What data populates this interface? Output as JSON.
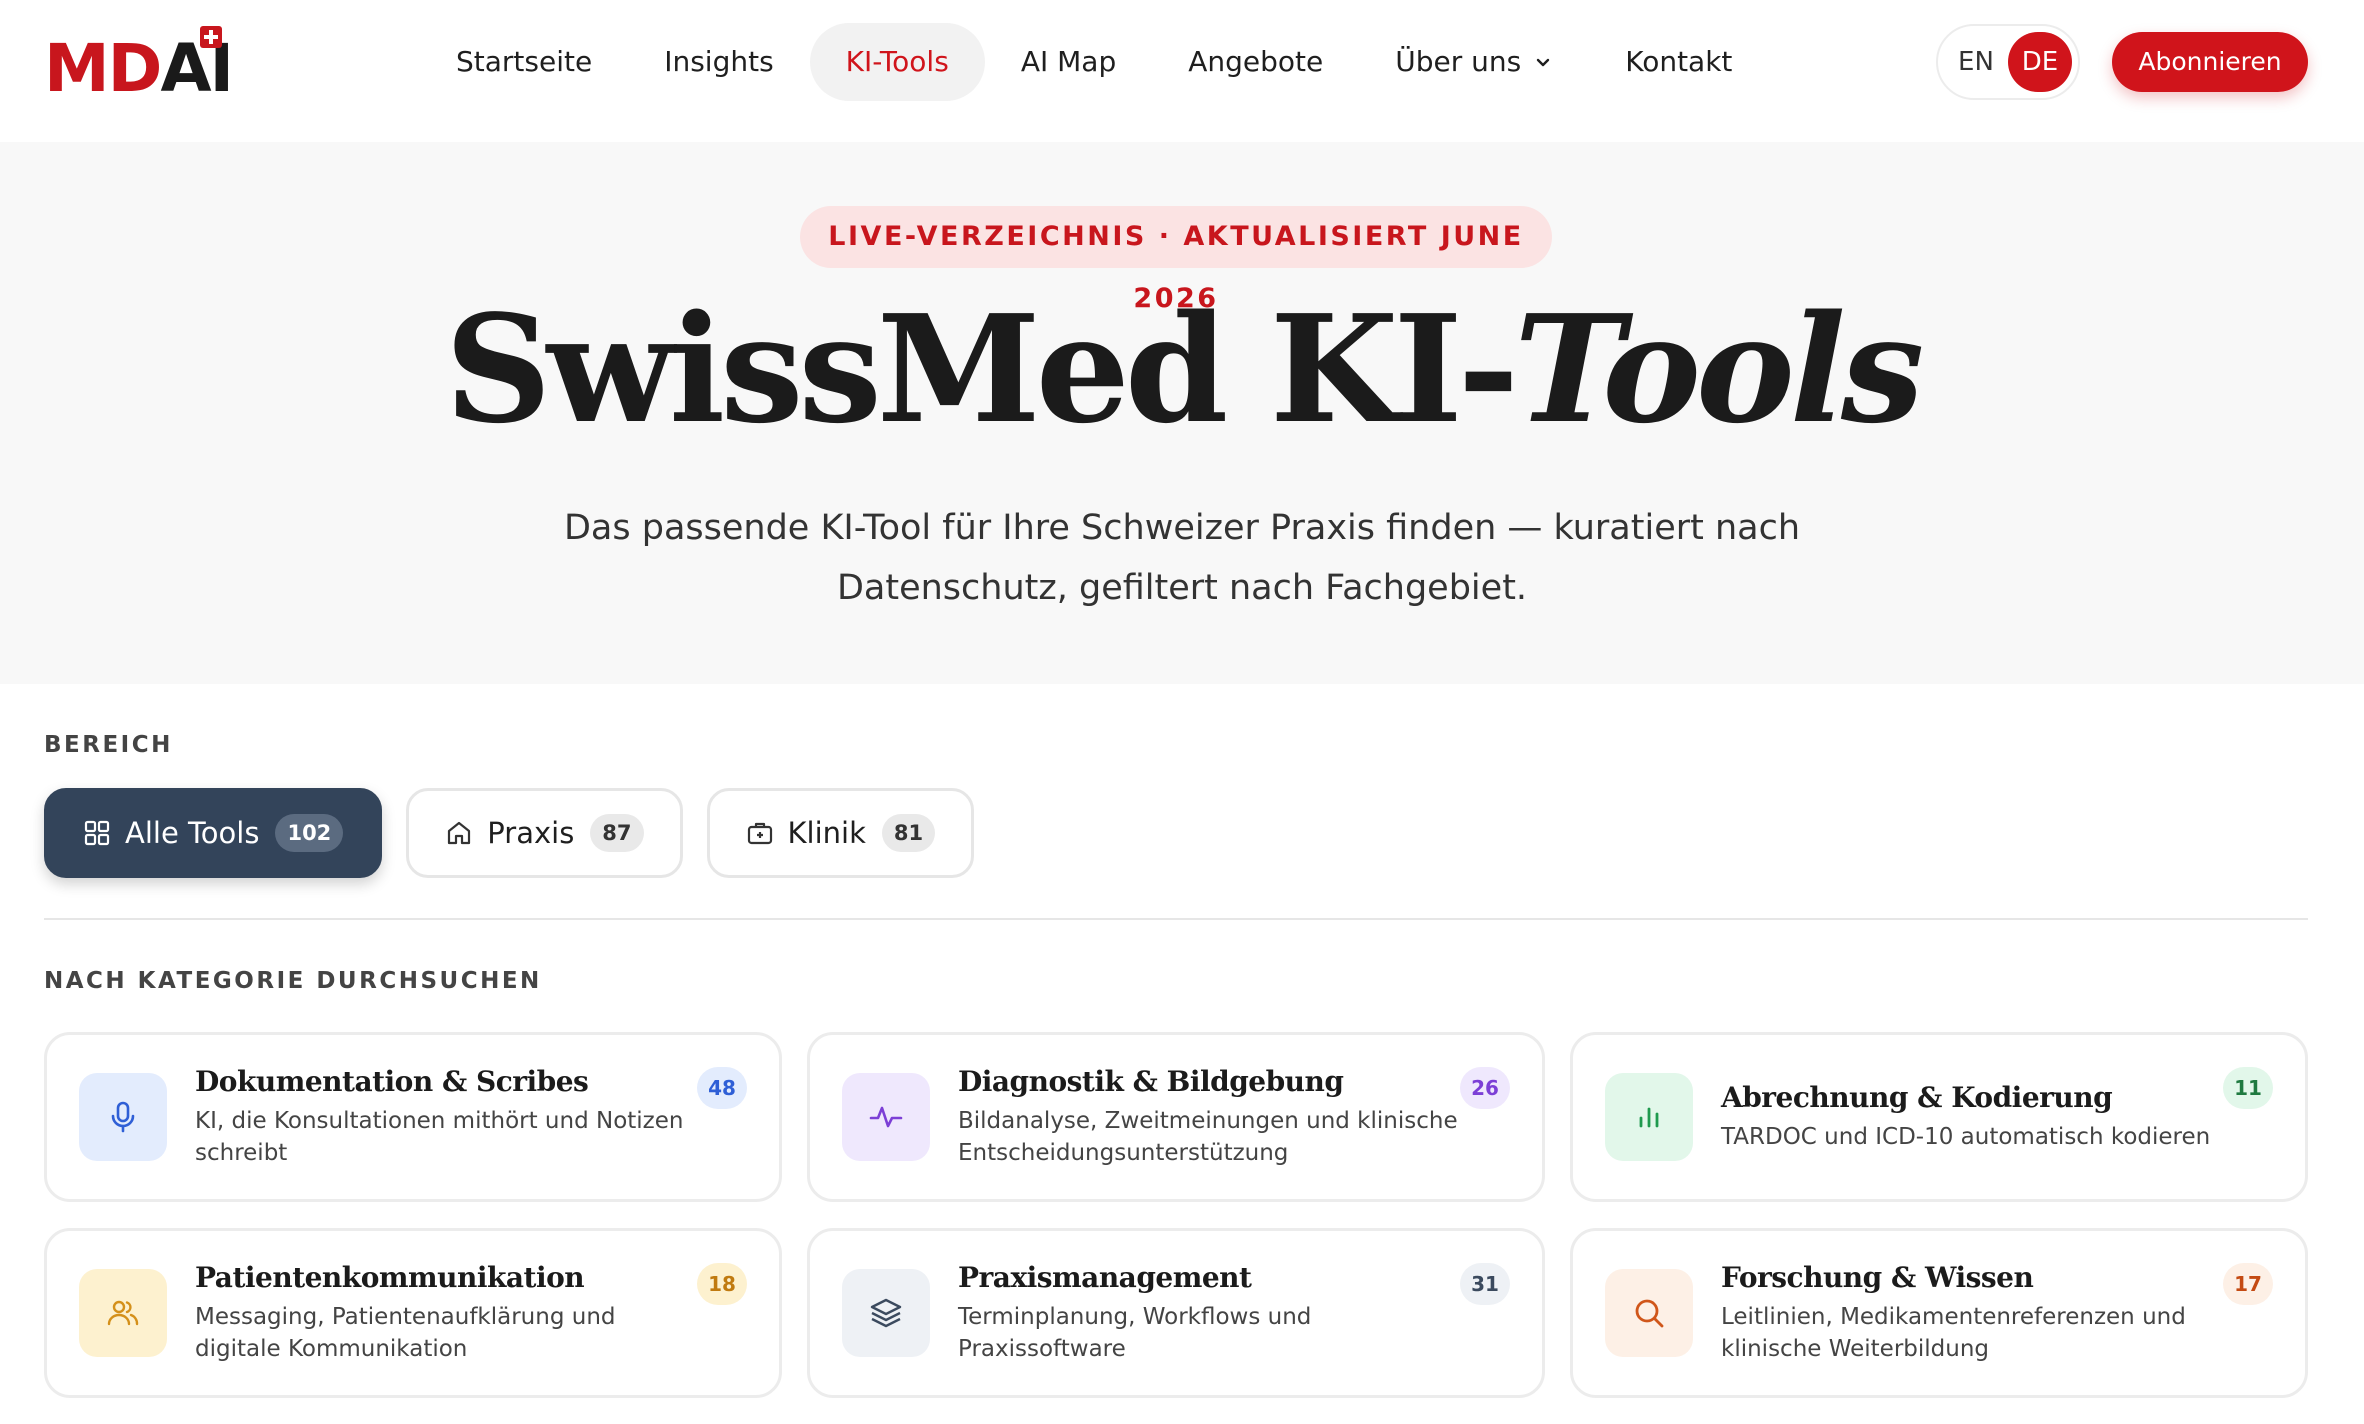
{
  "brand": {
    "logo_md": "MD",
    "logo_ai": "AI",
    "accent": "#d0141b"
  },
  "nav": {
    "items": [
      {
        "label": "Startseite"
      },
      {
        "label": "Insights"
      },
      {
        "label": "KI-Tools",
        "active": true
      },
      {
        "label": "AI Map"
      },
      {
        "label": "Angebote"
      },
      {
        "label": "Über uns",
        "dropdown": true
      },
      {
        "label": "Kontakt"
      }
    ]
  },
  "lang": {
    "en": "EN",
    "de": "DE",
    "selected": "DE"
  },
  "subscribe_label": "Abonnieren",
  "hero": {
    "pill": "LIVE-VERZEICHNIS · AKTUALISIERT JUNE 2026",
    "title_main": "SwissMed KI-",
    "title_italic": "Tools",
    "subtitle": "Das passende KI-Tool für Ihre Schweizer Praxis finden — kuratiert nach Datenschutz, gefiltert nach Fachgebiet."
  },
  "bereich": {
    "label": "BEREICH",
    "chips": [
      {
        "label": "Alle Tools",
        "count": "102",
        "icon": "grid-icon",
        "active": true
      },
      {
        "label": "Praxis",
        "count": "87",
        "icon": "home-icon"
      },
      {
        "label": "Klinik",
        "count": "81",
        "icon": "briefcase-icon"
      }
    ]
  },
  "kategorie": {
    "label": "NACH KATEGORIE DURCHSUCHEN",
    "cards": [
      {
        "title": "Dokumentation & Scribes",
        "desc": "KI, die Konsultationen mithört und Notizen schreibt",
        "count": "48",
        "icon": "microphone-icon",
        "bg": "#e3ecfd",
        "fg": "#2f5fd6",
        "badge_bg": "#e3ecfd",
        "badge_fg": "#2f5fd6"
      },
      {
        "title": "Diagnostik & Bildgebung",
        "desc": "Bildanalyse, Zweitmeinungen und klinische Entscheidungsunterstützung",
        "count": "26",
        "icon": "activity-icon",
        "bg": "#efe8fd",
        "fg": "#7c3fd6",
        "badge_bg": "#efe8fd",
        "badge_fg": "#7c3fd6"
      },
      {
        "title": "Abrechnung & Kodierung",
        "desc": "TARDOC und ICD-10 automatisch kodieren",
        "count": "11",
        "icon": "bar-chart-icon",
        "bg": "#e2f7ea",
        "fg": "#1f9a4e",
        "badge_bg": "#e2f7ea",
        "badge_fg": "#1f7a40"
      },
      {
        "title": "Patientenkommunikation",
        "desc": "Messaging, Patientenaufklärung und digitale Kommunikation",
        "count": "18",
        "icon": "users-icon",
        "bg": "#fdf1cf",
        "fg": "#d4901a",
        "badge_bg": "#fdf1cf",
        "badge_fg": "#c07a10"
      },
      {
        "title": "Praxismanagement",
        "desc": "Terminplanung, Workflows und Praxissoftware",
        "count": "31",
        "icon": "layers-icon",
        "bg": "#eef1f5",
        "fg": "#3b4a5e",
        "badge_bg": "#eef1f5",
        "badge_fg": "#3b4a5e"
      },
      {
        "title": "Forschung & Wissen",
        "desc": "Leitlinien, Medikamentenreferenzen und klinische Weiterbildung",
        "count": "17",
        "icon": "search-icon",
        "bg": "#fdf0e6",
        "fg": "#d0561a",
        "badge_bg": "#fdf0e6",
        "badge_fg": "#c44a12"
      }
    ]
  }
}
